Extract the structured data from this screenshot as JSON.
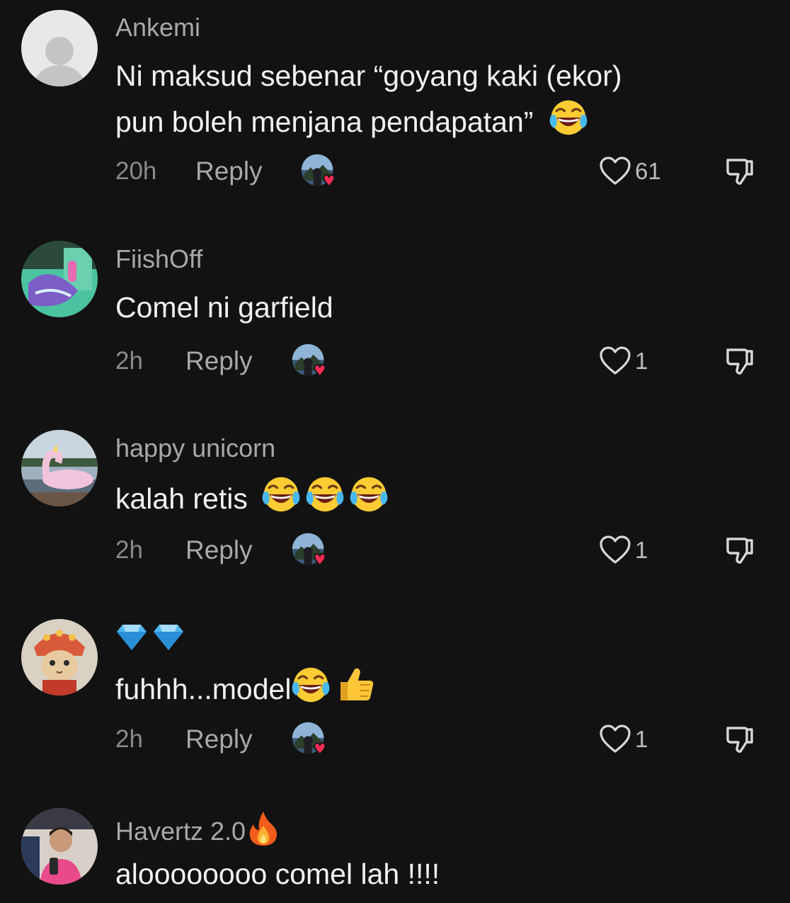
{
  "comments": [
    {
      "username": "Ankemi",
      "line1": "Ni maksud sebenar “goyang kaki (ekor)",
      "line2": "pun boleh menjana pendapatan”",
      "time": "20h",
      "reply": "Reply",
      "likes": "61",
      "avatar": "default-avatar"
    },
    {
      "username": "FiishOff",
      "line1": "Comel ni garfield",
      "time": "2h",
      "reply": "Reply",
      "likes": "1",
      "avatar": "garfield-avatar"
    },
    {
      "username": "happy unicorn",
      "line1": "kalah retis",
      "time": "2h",
      "reply": "Reply",
      "likes": "1",
      "avatar": "unicorn-float-avatar"
    },
    {
      "username": "",
      "line1": "fuhhh...model",
      "time": "2h",
      "reply": "Reply",
      "likes": "1",
      "avatar": "cat-costume-avatar"
    },
    {
      "username": "Havertz 2.0",
      "line1": "aloooooooo comel lah !!!!",
      "avatar": "person-avatar"
    }
  ],
  "icons": {
    "like": "heart-outline-icon",
    "dislike": "thumbs-down-icon",
    "creator_liked": "heart-badge-icon",
    "laughing": "face-with-tears-of-joy-emoji",
    "thumbs_up": "thumbs-up-emoji",
    "diamond": "gem-emoji",
    "fire": "fire-emoji"
  },
  "colors": {
    "background": "#121212",
    "username": "#a8a8a8",
    "text": "#f2f2f2",
    "meta": "#8a8a8a",
    "heart_badge": "#fe2c55"
  }
}
